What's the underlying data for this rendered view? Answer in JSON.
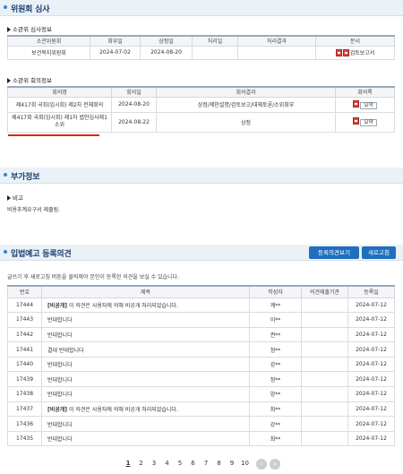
{
  "sections": {
    "committee_review": "위원회 심사",
    "additional_info": "부가정보",
    "legislative_notice": "입법예고 등록의견"
  },
  "review_info": {
    "title": "소관위 심사정보",
    "headers": [
      "소관위원회",
      "회부일",
      "상정일",
      "처리일",
      "처리결과",
      "문서"
    ],
    "row": {
      "committee": "보건복지위원회",
      "referral_date": "2024-07-02",
      "presented_date": "2024-08-20",
      "processed_date": "",
      "result": "",
      "doc_label": "검토보고서"
    }
  },
  "meeting_info": {
    "title": "소관위 회의정보",
    "headers": [
      "회의명",
      "회의일",
      "회의결과",
      "회의록"
    ],
    "rows": [
      {
        "name": "제417회 국회(임시회) 제2차 전체회의",
        "date": "2024-08-20",
        "result": "상정/제안설명/검토보고/대체토론/소위회부",
        "summary": "요약"
      },
      {
        "name": "제417회 국회(임시회) 제1차 법안심사제1소위",
        "date": "2024-08-22",
        "result": "상정",
        "summary": "요약"
      }
    ]
  },
  "remarks": {
    "title": "비고",
    "text": "비용추계요구서 제출됨."
  },
  "notice": {
    "register_button": "등록의견보기",
    "refresh_button": "새로고침",
    "description": "글쓰기 후 새로고침 버튼을 클릭해야 본인이 등록한 의견을 보실 수 있습니다.",
    "headers": [
      "번호",
      "제목",
      "작성자",
      "의견제출기관",
      "등록일"
    ],
    "rows": [
      {
        "no": "17444",
        "prefix": "[비공개]",
        "title": " 이 의견은 사용자에 의해 비공개 처리되었습니다.",
        "author": "계**",
        "org": "",
        "date": "2024-07-12"
      },
      {
        "no": "17443",
        "prefix": "",
        "title": "반대합니다",
        "author": "이**",
        "org": "",
        "date": "2024-07-12"
      },
      {
        "no": "17442",
        "prefix": "",
        "title": "반대합니다",
        "author": "권**",
        "org": "",
        "date": "2024-07-12"
      },
      {
        "no": "17441",
        "prefix": "",
        "title": "결대 반대합니다",
        "author": "정**",
        "org": "",
        "date": "2024-07-12"
      },
      {
        "no": "17440",
        "prefix": "",
        "title": "반대합니다",
        "author": "강**",
        "org": "",
        "date": "2024-07-12"
      },
      {
        "no": "17439",
        "prefix": "",
        "title": "반대합니다",
        "author": "정**",
        "org": "",
        "date": "2024-07-12"
      },
      {
        "no": "17438",
        "prefix": "",
        "title": "반대합니다",
        "author": "양**",
        "org": "",
        "date": "2024-07-12"
      },
      {
        "no": "17437",
        "prefix": "[비공개]",
        "title": " 이 의견은 사용자에 의해 비공개 처리되었습니다.",
        "author": "최**",
        "org": "",
        "date": "2024-07-12"
      },
      {
        "no": "17436",
        "prefix": "",
        "title": "반대합니다",
        "author": "강**",
        "org": "",
        "date": "2024-07-12"
      },
      {
        "no": "17435",
        "prefix": "",
        "title": "반대합니다",
        "author": "최**",
        "org": "",
        "date": "2024-07-12"
      }
    ]
  },
  "pagination": {
    "pages": [
      "1",
      "2",
      "3",
      "4",
      "5",
      "6",
      "7",
      "8",
      "9",
      "10"
    ],
    "current": "1",
    "next_icon": "chevron-right-icon",
    "last_icon": "double-chevron-right-icon"
  },
  "colors": {
    "section_bg": "#eaf1f7",
    "accent_blue": "#1f6fbe",
    "highlight_red": "#e0231c"
  }
}
